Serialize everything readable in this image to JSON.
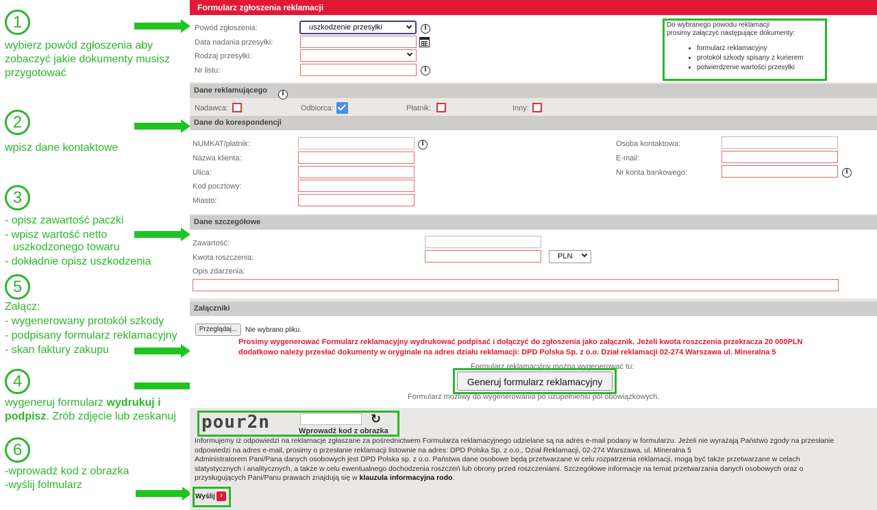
{
  "instructions": {
    "step1": {
      "number": "1",
      "text": "wybierz powód zgłoszenia aby zobaczyć jakie dokumenty musisz przygotować"
    },
    "step2": {
      "number": "2",
      "text": "wpisz dane kontaktowe"
    },
    "step3": {
      "number": "3",
      "lines": [
        "- opisz zawartość paczki",
        "- wpisz wartość netto",
        "uszkodzonego towaru",
        "- dokładnie opisz uszkodzenia"
      ]
    },
    "step5": {
      "number": "5",
      "lines": [
        "Załącz:",
        "- wygenerowany protokół szkody",
        "- podpisany formularz reklamacyjny",
        "- skan faktury zakupu"
      ]
    },
    "step4": {
      "number": "4",
      "text_a": "wygeneruj formularz ",
      "text_b": "wydrukuj i podpisz",
      "text_c": ". Zrób zdjęcie lub zeskanuj"
    },
    "step6": {
      "number": "6",
      "lines": [
        "-wprowadź kod z obrazka",
        "-wyślij folmularz"
      ]
    }
  },
  "form": {
    "title": "Formularz zgłoszenia reklamacji",
    "top": {
      "reason_label": "Powód zgłoszenia:",
      "reason_value": "uszkodzenie przesyłki",
      "date_label": "Data nadania przesyłki:",
      "type_label": "Rodzaj przesyłki:",
      "number_label": "Nr listu:",
      "docs_intro_1": "Do wybranego powodu reklamacji",
      "docs_intro_2": "prosimy załączyć następujące dokumenty:",
      "docs": [
        "formularz reklamacyjny",
        "protokół szkody spisany z kurierem",
        "potwierdzenie wartości przesyłki"
      ]
    },
    "claimant": {
      "heading": "Dane reklamującego",
      "options": [
        {
          "label": "Nadawca:",
          "checked": false
        },
        {
          "label": "Odbiorca:",
          "checked": true
        },
        {
          "label": "Płatnik:",
          "checked": false
        },
        {
          "label": "Inny:",
          "checked": false
        }
      ]
    },
    "correspondence": {
      "heading": "Dane do korespondencji",
      "numkat_label": "NUMKAT/płatnik:",
      "client_label": "Nazwa klienta:",
      "street_label": "Ulica:",
      "postcode_label": "Kod pocztowy:",
      "city_label": "Miasto:",
      "contact_label": "Osoba kontaktowa:",
      "email_label": "E-mail:",
      "account_label": "Nr konta bankowego:"
    },
    "details": {
      "heading": "Dane szczegółowe",
      "content_label": "Zawartość:",
      "amount_label": "Kwota roszczenia:",
      "currency": "PLN",
      "description_label": "Opis zdarzenia:"
    },
    "attachments": {
      "heading": "Załączniki",
      "browse_label": "Przeglądaj...",
      "no_file": "Nie wybrano pliku.",
      "note_1": "Prosimy wygenerować Formularz reklamacyjny wydrukować podpisać i dołączyć do zgłoszenia jako załącznik. Jeżeli kwota roszczenia przekracza 20 000PLN",
      "note_2": "dodatkowo należy przesłać dokumenty w oryginale na adres działu reklamacji: DPD Polska Sp. z o.o. Dział reklamacji 02-274 Warszawa ul. Mineralna 5",
      "gen_intro": "Formularz reklamacyjny można wygenerować tu:",
      "gen_button": "Generuj formularz reklamacyjny",
      "gen_after": "Formularz możliwy do wygenerowania po uzupełnieniu pól obowiązkowych."
    },
    "captcha": {
      "image_text": "pour2n",
      "prompt": "Wprowadź kod z obrazka"
    },
    "footer": {
      "line1": "Informujemy iż odpowiedzi na reklamacje zgłaszane za pośrednictwem Formularza reklamacyjnego udzielane są na adres e-mail podany w formularzu. Jeżeli nie wyrażają Państwo zgody na przesłanie",
      "line2": "odpowiedzi na adres e-mail, prosimy o przesłanie reklamacji listownie na adres: DPD Polska Sp. z o.o., Dział Reklamacji, 02-274 Warszawa, ul. Mineralna 5",
      "line3": "Administratorem Pani/Pana danych osobowych jest DPD Polska sp. z o.o. Państwa dane osobowe będą przetwarzane w celu rozpatrzenia reklamacji, mogą być także przetwarzane w celach",
      "line4": "statystycznych i analitycznych, a także w celu ewentualnego dochodzenia roszczeń lub obrony przed roszczeniami. Szczegółowe informacje na temat przetwarzania danych osobowych oraz o",
      "line5a": "przysługujących Pani/Panu prawach znajdują się w ",
      "line5b": "klauzula informacyjna rodo",
      "line5c": "."
    },
    "send_label": "Wyślij"
  }
}
